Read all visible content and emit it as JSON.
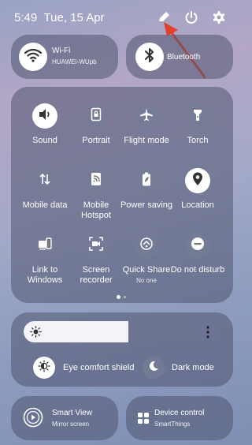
{
  "status_bar": {
    "time": "5:49",
    "date": "Tue, 15 Apr"
  },
  "wifi": {
    "title": "Wi-Fi",
    "network": "HUAWEI-WUpb"
  },
  "bluetooth": {
    "title": "Bluetooth"
  },
  "tiles": [
    {
      "label": "Sound",
      "state": "on"
    },
    {
      "label": "Portrait",
      "state": "off"
    },
    {
      "label": "Flight mode",
      "state": "off"
    },
    {
      "label": "Torch",
      "state": "off"
    },
    {
      "label": "Mobile data",
      "state": "off"
    },
    {
      "label": "Mobile Hotspot",
      "state": "off"
    },
    {
      "label": "Power saving",
      "state": "off"
    },
    {
      "label": "Location",
      "state": "on"
    },
    {
      "label": "Link to Windows",
      "state": "off"
    },
    {
      "label": "Screen recorder",
      "state": "off"
    },
    {
      "label": "Quick Share",
      "sub": "No one",
      "state": "off"
    },
    {
      "label": "Do not disturb",
      "state": "off"
    }
  ],
  "brightness": {
    "level": 0.53
  },
  "display_toggles": {
    "eye_comfort": "Eye comfort shield",
    "dark_mode": "Dark mode"
  },
  "bottom_cards": {
    "smart_view": {
      "title": "Smart View",
      "sub": "Mirror screen"
    },
    "device_control": {
      "title": "Device control",
      "sub": "SmartThings"
    }
  },
  "colors": {
    "annotation_arrow": "#e0432c"
  }
}
